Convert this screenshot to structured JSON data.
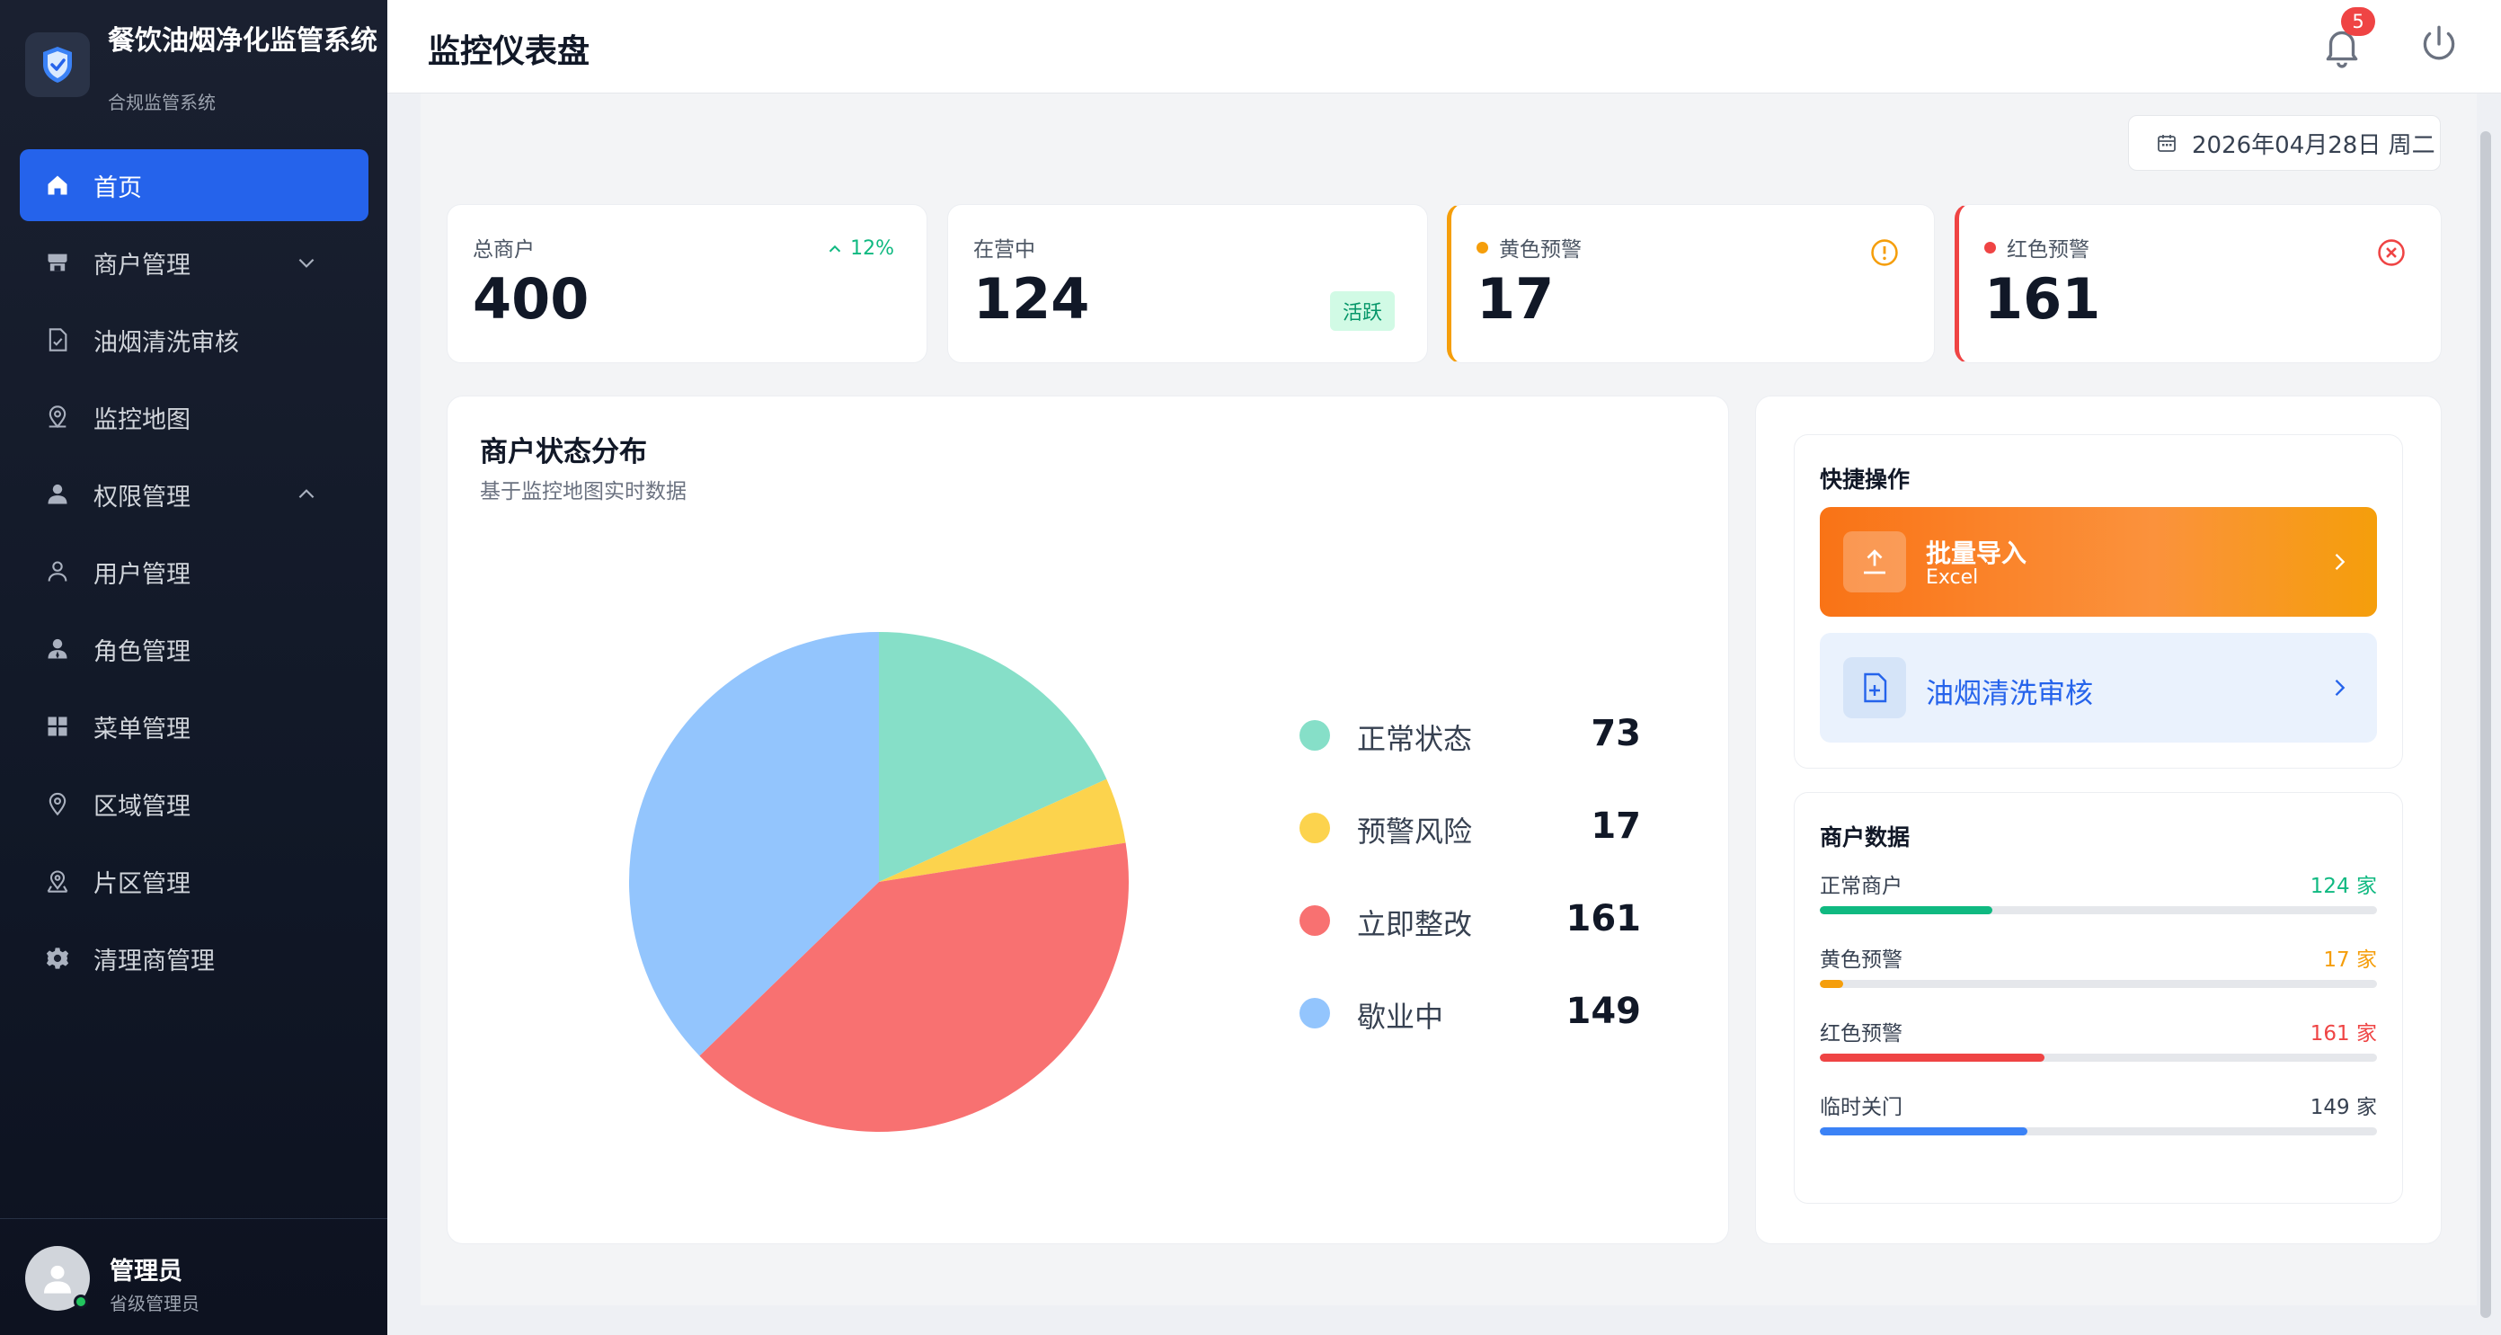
{
  "app": {
    "title": "餐饮油烟净化监管系统",
    "subtitle": "合规监管系统"
  },
  "sidebar": {
    "items": [
      {
        "label": "首页",
        "icon": "home-icon",
        "active": true
      },
      {
        "label": "商户管理",
        "icon": "store-icon",
        "expandable": true,
        "expanded": false
      },
      {
        "label": "油烟清洗审核",
        "icon": "document-check-icon"
      },
      {
        "label": "监控地图",
        "icon": "map-pin-icon"
      },
      {
        "label": "权限管理",
        "icon": "user-icon",
        "expandable": true,
        "expanded": true
      },
      {
        "label": "用户管理",
        "icon": "user-outline-icon"
      },
      {
        "label": "角色管理",
        "icon": "user-role-icon"
      },
      {
        "label": "菜单管理",
        "icon": "grid-icon"
      },
      {
        "label": "区域管理",
        "icon": "location-icon"
      },
      {
        "label": "片区管理",
        "icon": "map-location-icon"
      },
      {
        "label": "清理商管理",
        "icon": "gear-icon"
      }
    ]
  },
  "user": {
    "name": "管理员",
    "role": "省级管理员",
    "online": true
  },
  "header": {
    "title": "监控仪表盘",
    "notification_count": "5"
  },
  "date": {
    "text": "2026年04月28日 周二"
  },
  "stats": {
    "total": {
      "label": "总商户",
      "value": "400",
      "trend": "12%"
    },
    "operating": {
      "label": "在营中",
      "value": "124",
      "badge": "活跃"
    },
    "yellow": {
      "label": "黄色预警",
      "value": "17",
      "color": "#f59e0b"
    },
    "red": {
      "label": "红色预警",
      "value": "161",
      "color": "#ef4444"
    }
  },
  "distribution": {
    "title": "商户状态分布",
    "subtitle": "基于监控地图实时数据"
  },
  "chart_data": {
    "type": "pie",
    "categories": [
      "正常状态",
      "预警风险",
      "立即整改",
      "歇业中"
    ],
    "values": [
      73,
      17,
      161,
      149
    ],
    "colors": [
      "#86dfc8",
      "#fcd34d",
      "#f87171",
      "#93c5fd"
    ],
    "legend_position": "right"
  },
  "quick_actions": {
    "title": "快捷操作",
    "import": {
      "label": "批量导入",
      "sub": "Excel"
    },
    "audit": {
      "label": "油烟清洗审核"
    }
  },
  "merchant_data": {
    "title": "商户数据",
    "rows": [
      {
        "label": "正常商户",
        "value": "124 家",
        "ratio": 0.31,
        "color": "#10b981",
        "text_color": "#10b981"
      },
      {
        "label": "黄色预警",
        "value": "17 家",
        "ratio": 0.0425,
        "color": "#f59e0b",
        "text_color": "#f59e0b"
      },
      {
        "label": "红色预警",
        "value": "161 家",
        "ratio": 0.4025,
        "color": "#ef4444",
        "text_color": "#ef4444"
      },
      {
        "label": "临时关门",
        "value": "149 家",
        "ratio": 0.3725,
        "color": "#3b82f6",
        "text_color": "#374151"
      }
    ]
  }
}
